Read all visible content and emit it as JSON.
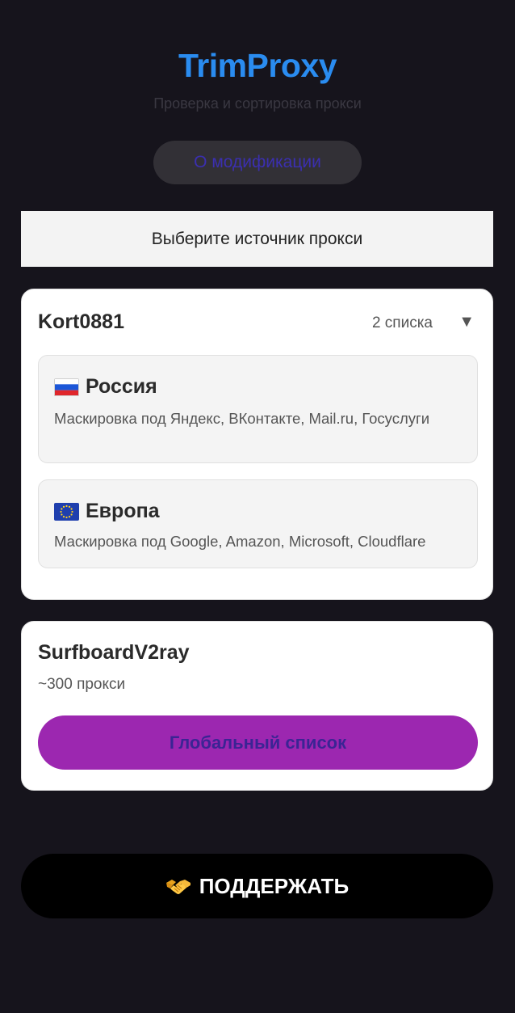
{
  "header": {
    "title": "TrimProxy",
    "subtitle": "Проверка и сортировка прокси",
    "about_label": "О модификации"
  },
  "source_banner": "Выберите источник прокси",
  "kort": {
    "title": "Kort0881",
    "count": "2 списка",
    "toggle_icon": "chevron-down-icon",
    "items": [
      {
        "flag": "russia-flag-icon",
        "title": "Россия",
        "desc": "Маскировка под Яндекс, ВКонтакте, Mail.ru, Госуслуги"
      },
      {
        "flag": "eu-flag-icon",
        "title": "Европа",
        "desc": "Маскировка под Google, Amazon, Microsoft, Cloudflare"
      }
    ]
  },
  "surf": {
    "title": "SurfboardV2ray",
    "count": "~300 прокси",
    "button_label": "Глобальный список"
  },
  "support": {
    "icon": "handshake-icon",
    "label": "ПОДДЕРЖАТЬ"
  },
  "colors": {
    "background": "#16141c",
    "title_blue": "#2a8cf0",
    "accent_purple": "#9c27b0",
    "button_black": "#000000"
  }
}
